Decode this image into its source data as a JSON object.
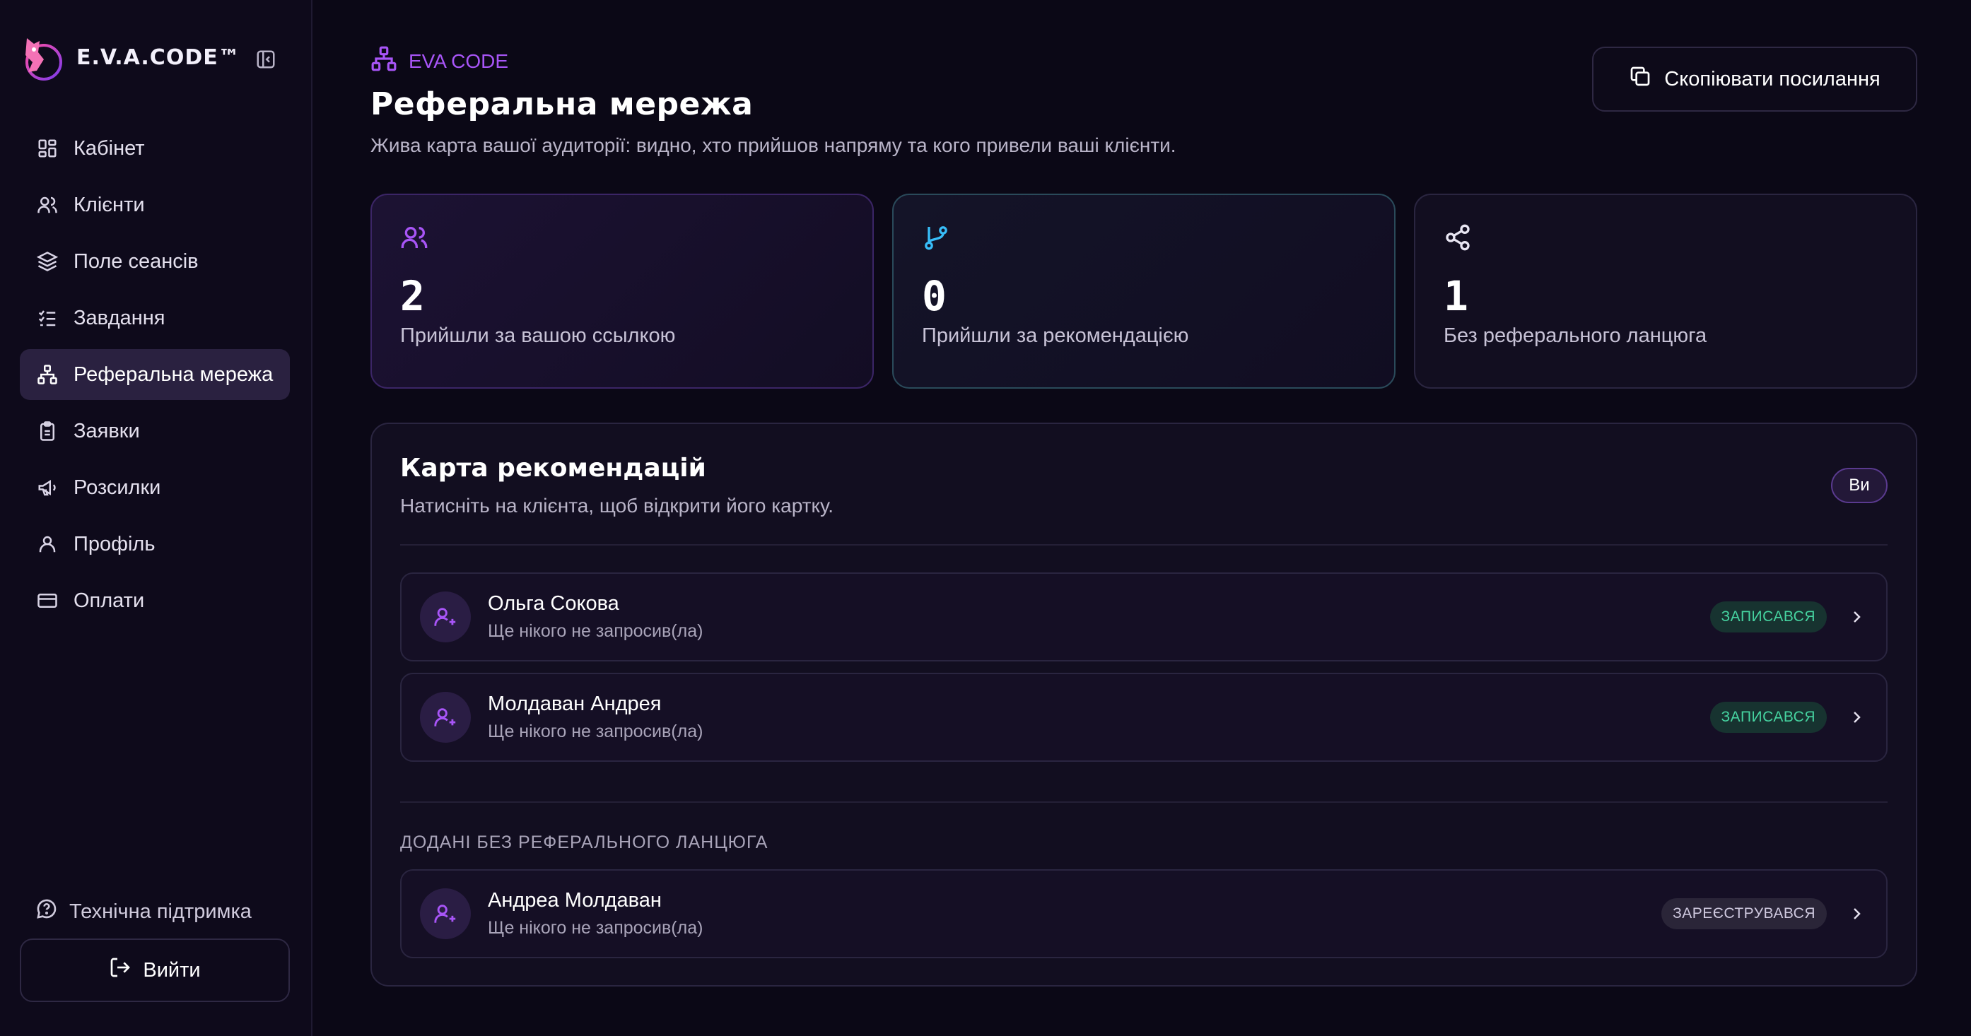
{
  "brand": {
    "name": "E.V.A.CODE™"
  },
  "sidebar": {
    "items": [
      {
        "label": "Кабінет",
        "icon": "dashboard-icon",
        "active": false
      },
      {
        "label": "Клієнти",
        "icon": "users-icon",
        "active": false
      },
      {
        "label": "Поле сеансів",
        "icon": "layers-icon",
        "active": false
      },
      {
        "label": "Завдання",
        "icon": "checklist-icon",
        "active": false
      },
      {
        "label": "Реферальна мережа",
        "icon": "network-icon",
        "active": true
      },
      {
        "label": "Заявки",
        "icon": "clipboard-icon",
        "active": false
      },
      {
        "label": "Розсилки",
        "icon": "megaphone-icon",
        "active": false
      },
      {
        "label": "Профіль",
        "icon": "user-icon",
        "active": false
      },
      {
        "label": "Оплати",
        "icon": "credit-card-icon",
        "active": false
      }
    ],
    "support_label": "Технічна підтримка",
    "logout_label": "Вийти"
  },
  "header": {
    "breadcrumb": "EVA CODE",
    "title": "Реферальна мережа",
    "subtitle": "Жива карта вашої аудиторії: видно, хто прийшов напряму та кого привели ваші клієнти.",
    "copy_button": "Скопіювати посилання"
  },
  "stats": [
    {
      "value": "2",
      "label": "Прийшли за вашою ссылкою",
      "icon": "users-icon",
      "color": "#a855f7"
    },
    {
      "value": "0",
      "label": "Прийшли за рекомендацією",
      "icon": "git-branch-icon",
      "color": "#38bdf8"
    },
    {
      "value": "1",
      "label": "Без реферального ланцюга",
      "icon": "share-icon",
      "color": "#e9e6f3"
    }
  ],
  "map": {
    "title": "Карта рекомендацій",
    "subtitle": "Натисніть на клієнта, щоб відкрити його картку.",
    "you_badge": "Ви",
    "referred": [
      {
        "name": "Ольга Сокова",
        "note": "Ще нікого не запросив(ла)",
        "status": "ЗАПИСАВСЯ"
      },
      {
        "name": "Молдаван Андрея",
        "note": "Ще нікого не запросив(ла)",
        "status": "ЗАПИСАВСЯ"
      }
    ],
    "no_chain_label": "ДОДАНІ БЕЗ РЕФЕРАЛЬНОГО ЛАНЦЮГА",
    "no_chain": [
      {
        "name": "Андреа Молдаван",
        "note": "Ще нікого не запросив(ла)",
        "status": "ЗАРЕЄСТРУВАВСЯ"
      }
    ]
  },
  "colors": {
    "accent": "#a855f7",
    "success": "#46d3a0",
    "info": "#38bdf8",
    "background": "#0b0816"
  }
}
